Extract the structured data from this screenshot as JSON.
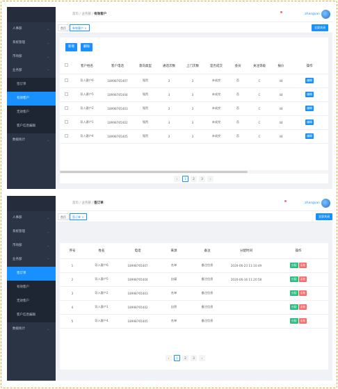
{
  "panel1": {
    "breadcrumb": [
      "首页",
      "业务部",
      "有效客户"
    ],
    "username": "zhangsan",
    "tags": [
      {
        "label": "首页"
      },
      {
        "label": "有效客户 ×"
      }
    ],
    "close_all": "全部关闭",
    "sidebar": {
      "items": [
        {
          "label": "人事部",
          "chev": "⌄"
        },
        {
          "label": "系统管理",
          "chev": "⌄"
        },
        {
          "label": "市场部",
          "chev": "⌄"
        },
        {
          "label": "业务部",
          "chev": "⌃"
        }
      ],
      "subitems": [
        {
          "label": "签订单",
          "active": false
        },
        {
          "label": "有效客户",
          "active": true
        },
        {
          "label": "无效客户",
          "active": false
        },
        {
          "label": "客户信息编辑",
          "active": false
        }
      ],
      "after": [
        {
          "label": "数据统计",
          "chev": "⌄"
        }
      ]
    },
    "buttons": {
      "add": "新增",
      "delete": "删除"
    },
    "columns": [
      "",
      "客户姓名",
      "客户电话",
      "意向类型",
      "通话次数",
      "上门次数",
      "是否成交",
      "会员",
      "关注等级",
      "报价",
      "操作"
    ],
    "rows": [
      [
        "导入客户6",
        "18998765407",
        "强烈",
        "3",
        "3",
        "未成交",
        "否",
        "C",
        "44",
        "编辑"
      ],
      [
        "导入客户5",
        "18998765404",
        "强烈",
        "3",
        "3",
        "未成交",
        "否",
        "C",
        "44",
        "编辑"
      ],
      [
        "导入客户2",
        "18998765403",
        "强烈",
        "3",
        "3",
        "未成交",
        "否",
        "C",
        "44",
        "编辑"
      ],
      [
        "导入客户1",
        "18998765402",
        "强烈",
        "3",
        "3",
        "未成交",
        "否",
        "C",
        "44",
        "编辑"
      ],
      [
        "导入客户4",
        "18998765405",
        "强烈",
        "3",
        "3",
        "未成交",
        "否",
        "C",
        "44",
        "编辑"
      ]
    ],
    "pagination": [
      "‹",
      "1",
      "2",
      "3",
      "›"
    ]
  },
  "panel2": {
    "breadcrumb": [
      "首页",
      "业务部",
      "签订单"
    ],
    "username": "zhangsan",
    "tags": [
      {
        "label": "首页"
      },
      {
        "label": "签订单 ×"
      }
    ],
    "close_all": "全部关闭",
    "sidebar": {
      "items": [
        {
          "label": "人事部",
          "chev": "⌄"
        },
        {
          "label": "系统管理",
          "chev": "⌄"
        },
        {
          "label": "市场部",
          "chev": "⌄"
        },
        {
          "label": "业务部",
          "chev": "⌃"
        }
      ],
      "subitems": [
        {
          "label": "签订单",
          "active": true
        },
        {
          "label": "有效客户",
          "active": false
        },
        {
          "label": "无效客户",
          "active": false
        },
        {
          "label": "客户信息编辑",
          "active": false
        }
      ],
      "after": [
        {
          "label": "数据统计",
          "chev": "⌄"
        }
      ]
    },
    "columns": [
      "序号",
      "姓名",
      "电话",
      "来源",
      "备注",
      "分配时间",
      "操作"
    ],
    "rows": [
      [
        "1",
        "导入客户6",
        "18998765407",
        "名单",
        "备注信息",
        "2020-06-23 11:10:49",
        "分配",
        "无效"
      ],
      [
        "2",
        "导入客户5",
        "18998765404",
        "自媒",
        "备注信息",
        "2020-06-16 11:20:58",
        "分配",
        "无效"
      ],
      [
        "3",
        "导入客户2",
        "18998765403",
        "名单",
        "备注信息",
        "",
        "分配",
        "无效"
      ],
      [
        "4",
        "导入客户1",
        "18998765402",
        "自然",
        "备注信息",
        "",
        "分配",
        "无效"
      ],
      [
        "5",
        "导入客户4",
        "18998765405",
        "名单",
        "备注信息",
        "",
        "分配",
        "无效"
      ]
    ],
    "pagination": [
      "‹",
      "1",
      "2",
      "3",
      "›"
    ]
  }
}
